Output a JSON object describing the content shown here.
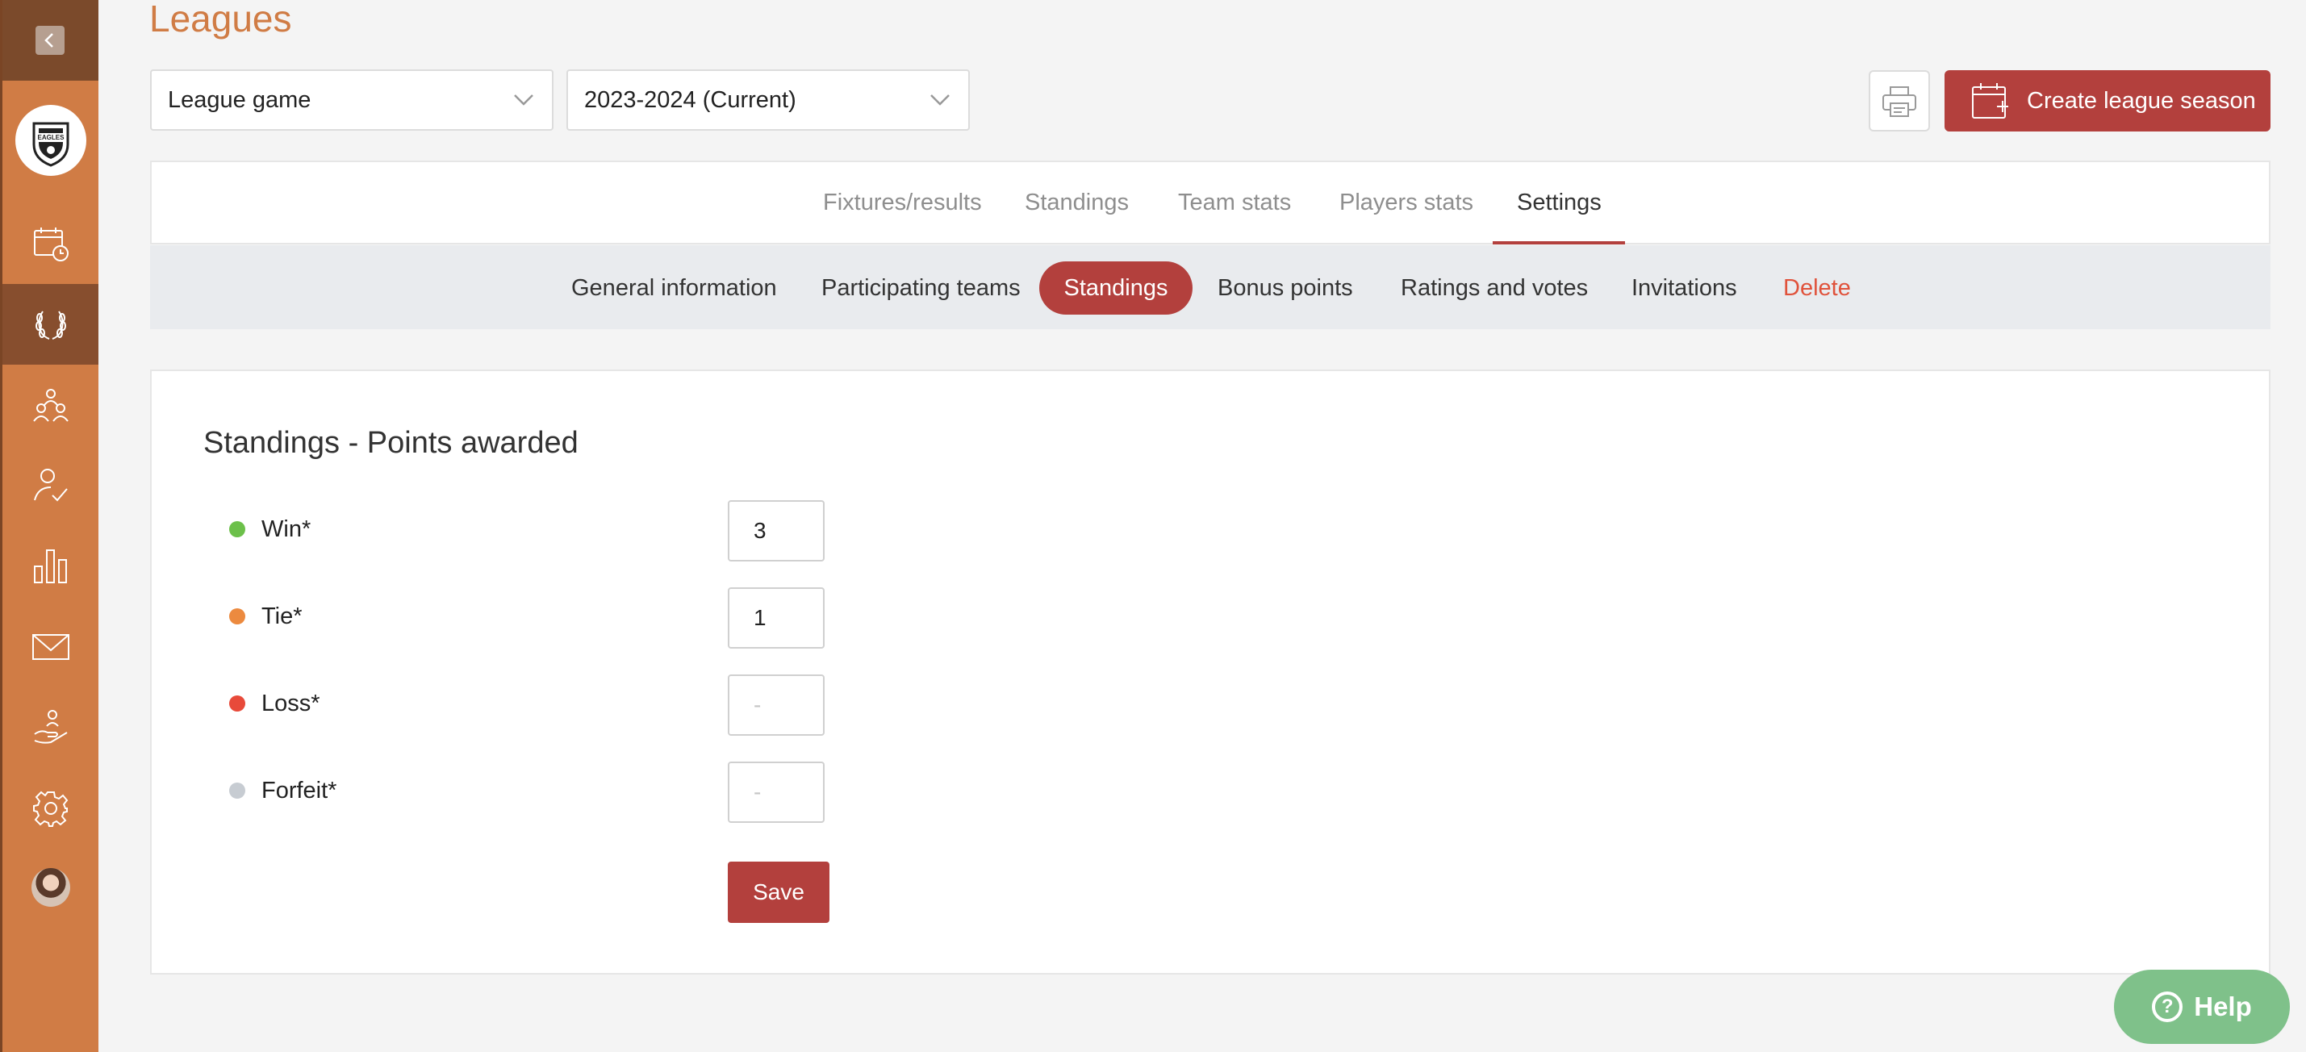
{
  "app": {
    "page_title": "Leagues",
    "brand_colors": {
      "accent": "#d07c45",
      "primary": "#b3403d",
      "help": "#7fc18a"
    }
  },
  "sidebar": {
    "logo_text": "EAGLES",
    "items": [
      {
        "icon": "calendar-clock-icon",
        "active": false
      },
      {
        "icon": "laurel-trophy-icon",
        "active": true
      },
      {
        "icon": "team-users-icon",
        "active": false
      },
      {
        "icon": "user-check-icon",
        "active": false
      },
      {
        "icon": "bar-chart-icon",
        "active": false
      },
      {
        "icon": "mail-icon",
        "active": false
      },
      {
        "icon": "hand-user-icon",
        "active": false
      },
      {
        "icon": "gear-icon",
        "active": false
      }
    ]
  },
  "filters": {
    "competition": "League game",
    "season": "2023-2024 (Current)"
  },
  "actions": {
    "create_season": "Create league season"
  },
  "tabs": [
    {
      "label": "Fixtures/results",
      "active": false
    },
    {
      "label": "Standings",
      "active": false
    },
    {
      "label": "Team stats",
      "active": false
    },
    {
      "label": "Players stats",
      "active": false
    },
    {
      "label": "Settings",
      "active": true
    }
  ],
  "subtabs": [
    {
      "label": "General information",
      "active": false
    },
    {
      "label": "Participating teams",
      "active": false
    },
    {
      "label": "Standings",
      "active": true
    },
    {
      "label": "Bonus points",
      "active": false
    },
    {
      "label": "Ratings and votes",
      "active": false
    },
    {
      "label": "Invitations",
      "active": false
    },
    {
      "label": "Delete",
      "active": false,
      "danger": true
    }
  ],
  "points": {
    "title": "Standings - Points awarded",
    "rows": [
      {
        "label": "Win*",
        "value": "3",
        "placeholder": "",
        "dot_color": "#6cc04a"
      },
      {
        "label": "Tie*",
        "value": "1",
        "placeholder": "",
        "dot_color": "#ec8a3f"
      },
      {
        "label": "Loss*",
        "value": "",
        "placeholder": "-",
        "dot_color": "#e84a3a"
      },
      {
        "label": "Forfeit*",
        "value": "",
        "placeholder": "-",
        "dot_color": "#c7ccd2"
      }
    ],
    "save_label": "Save"
  },
  "help": {
    "label": "Help"
  }
}
